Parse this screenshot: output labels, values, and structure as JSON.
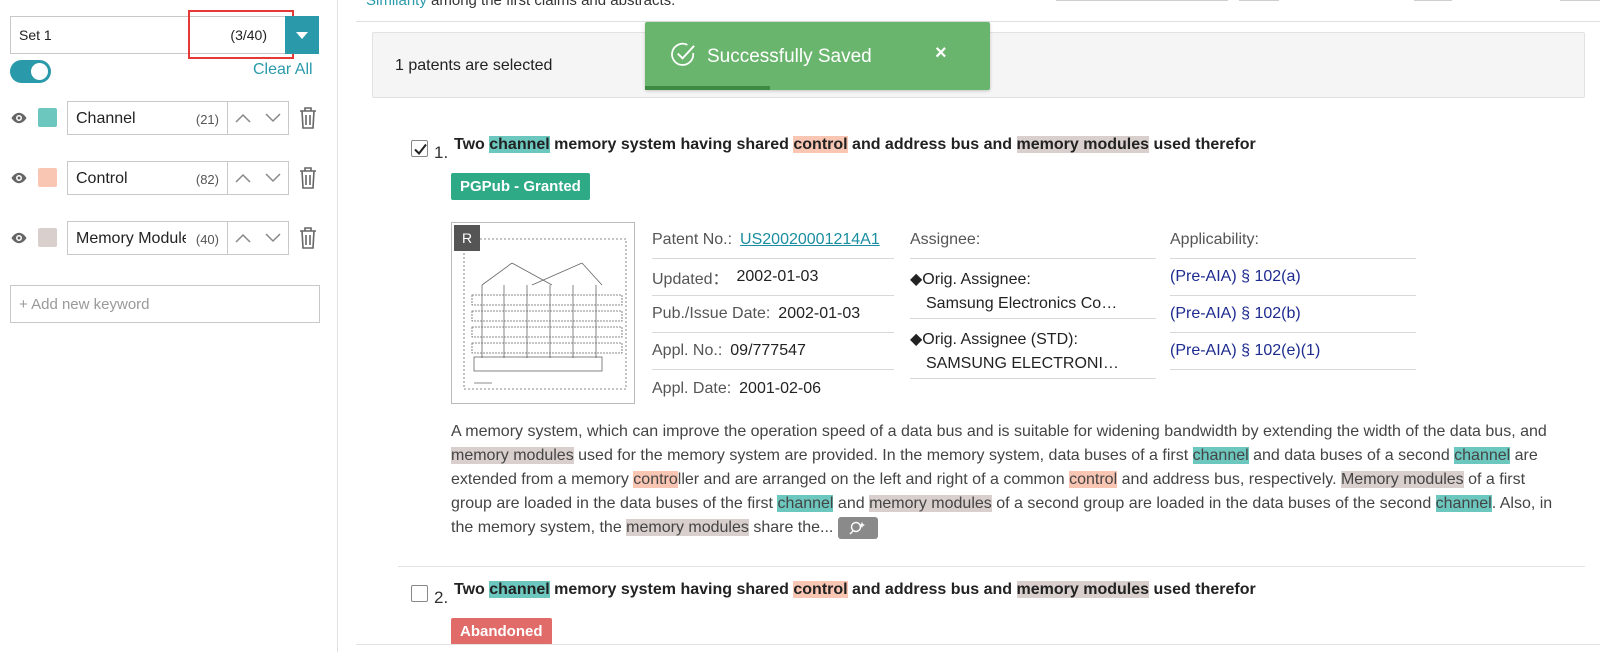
{
  "sidebar": {
    "set": {
      "name": "Set 1",
      "count": "(3/40)"
    },
    "clear_all": "Clear All",
    "keywords": [
      {
        "label": "Channel",
        "count": "(21)",
        "color": "#6cc7bf"
      },
      {
        "label": "Control",
        "count": "(82)",
        "color": "#f9c6b4"
      },
      {
        "label": "Memory Modules",
        "count": "(40)",
        "color": "#d9d0cd"
      }
    ],
    "add_placeholder": "+ Add new keyword"
  },
  "top_text": {
    "link": "Similarity",
    "rest": " among the first claims and abstracts."
  },
  "selection": {
    "text": "1 patents are selected"
  },
  "toast": {
    "text": "Successfully Saved",
    "close": "×",
    "color": "#6ab56e"
  },
  "results": [
    {
      "number": "1.",
      "checked": true,
      "title": [
        "Two ",
        "channel",
        " memory system having shared ",
        "control",
        " and address bus and ",
        "memory modules",
        " used therefor"
      ],
      "badge": {
        "text": "PGPub - Granted",
        "color": "#2eaa86"
      },
      "thumb_label": "R",
      "patent_no_label": "Patent No.:",
      "patent_no": "US20020001214A1",
      "updated_label": "Updated：",
      "updated": "2002-01-03",
      "pub_label": "Pub./Issue Date:",
      "pub_date": "2002-01-03",
      "appl_no_label": "Appl. No.:",
      "appl_no": "09/777547",
      "appl_date_label": "Appl. Date:",
      "appl_date": "2001-02-06",
      "assignee_label": "Assignee:",
      "orig_assignee_label": "◆Orig. Assignee:",
      "orig_assignee": "Samsung Electronics Co…",
      "orig_assignee_std_label": "◆Orig. Assignee (STD):",
      "orig_assignee_std": "SAMSUNG ELECTRONI…",
      "applicability_label": "Applicability:",
      "applicability": [
        "(Pre-AIA) § 102(a)",
        "(Pre-AIA) § 102(b)",
        "(Pre-AIA) § 102(e)(1)"
      ],
      "abstract": [
        [
          "t",
          "A memory system, which can improve the operation speed of a data bus and is suitable for widening bandwidth by extending the width of the data bus, and "
        ],
        [
          "mm",
          "memory modules"
        ],
        [
          "t",
          " used for the memory system are provided. In the memory system, data buses of a first "
        ],
        [
          "ch",
          "channel"
        ],
        [
          "t",
          " and data buses of a second "
        ],
        [
          "ch",
          "channel"
        ],
        [
          "t",
          " are extended from a memory "
        ],
        [
          "ct",
          "contro"
        ],
        [
          "t",
          "ller and are arranged on the left and right of a common "
        ],
        [
          "ct",
          "control"
        ],
        [
          "t",
          " and address bus, respectively. "
        ],
        [
          "mm",
          "Memory modules"
        ],
        [
          "t",
          " of a first group are loaded in the data buses of the first "
        ],
        [
          "ch",
          "channel"
        ],
        [
          "t",
          " and "
        ],
        [
          "mm",
          "memory modules"
        ],
        [
          "t",
          " of a second group are loaded in the data buses of the second "
        ],
        [
          "ch",
          "channel"
        ],
        [
          "t",
          ". Also, in the memory system, the "
        ],
        [
          "mm",
          "memory modules"
        ],
        [
          "t",
          " share the..."
        ]
      ]
    },
    {
      "number": "2.",
      "checked": false,
      "title": [
        "Two ",
        "channel",
        " memory system having shared ",
        "control",
        " and address bus and ",
        "memory modules",
        " used therefor"
      ],
      "badge": {
        "text": "Abandoned",
        "color": "#e06b68"
      }
    }
  ],
  "colors": {
    "accent": "#2a9aaa",
    "channel": "#6cc7bf",
    "control": "#f9c6b4",
    "memory_modules": "#d9d0cd"
  }
}
